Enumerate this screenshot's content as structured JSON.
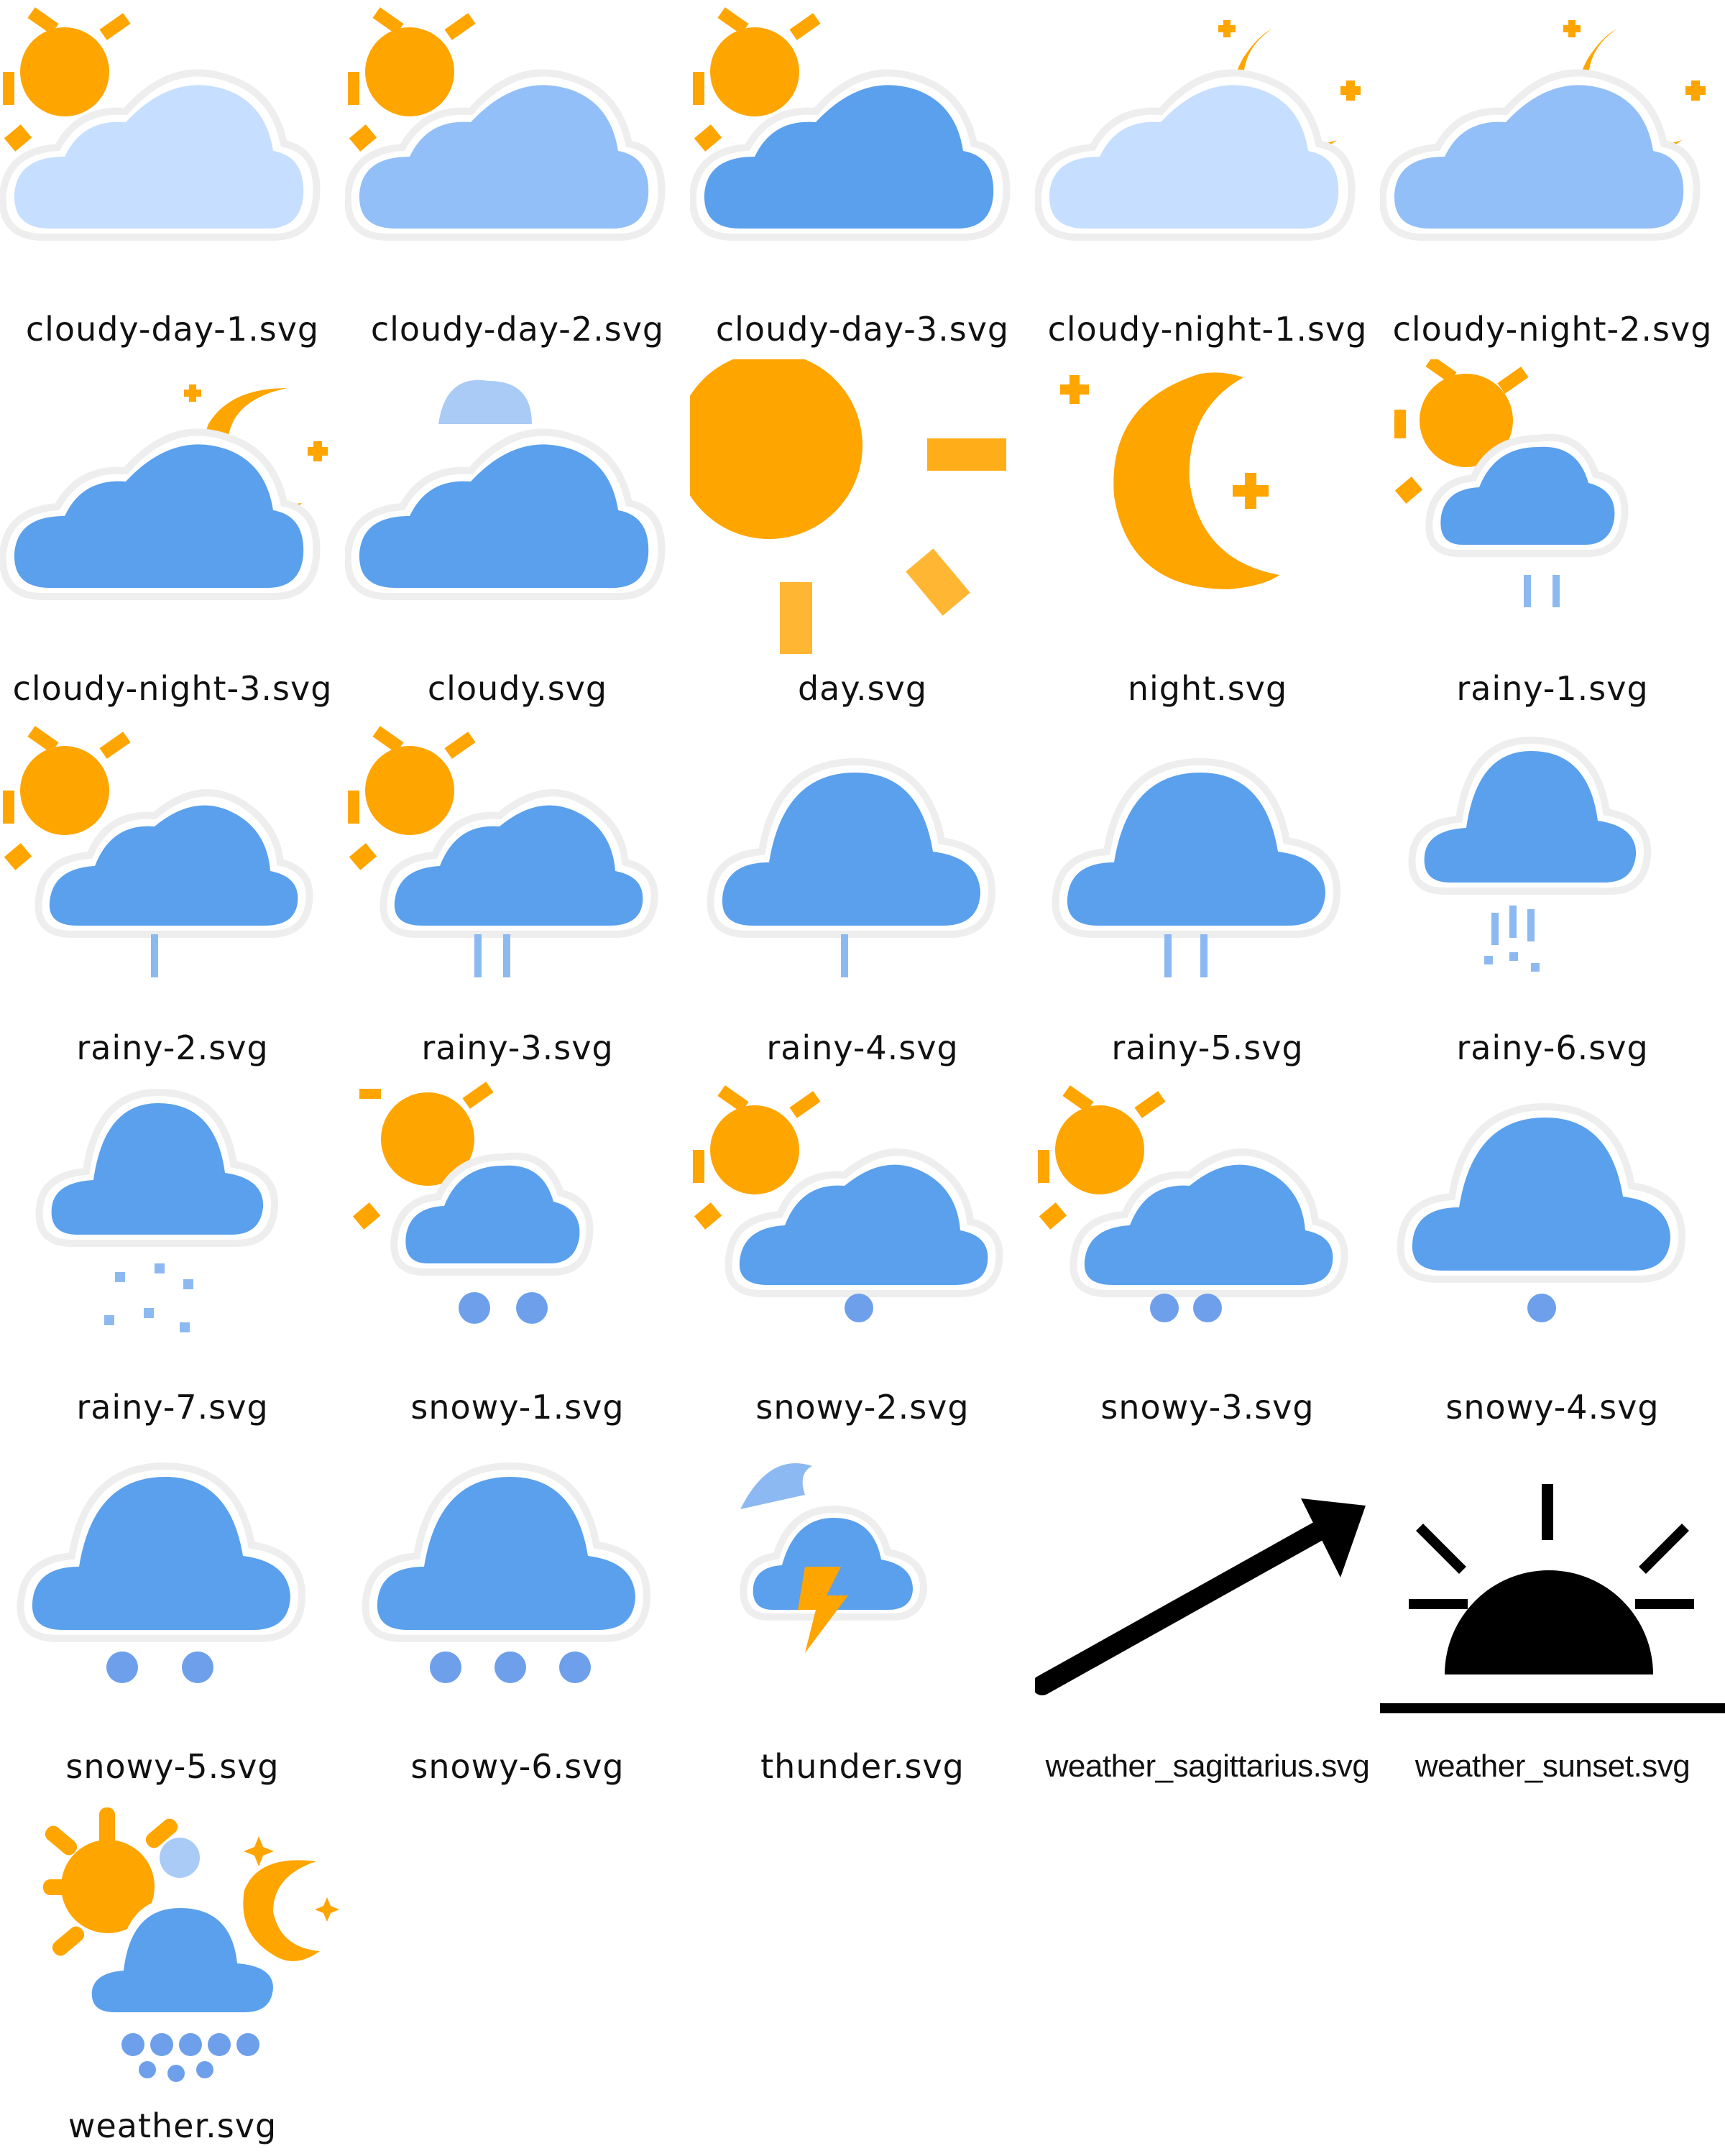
{
  "files": [
    {
      "name": "cloudy-day-1.svg",
      "icon": "cloudy-day-1-icon"
    },
    {
      "name": "cloudy-day-2.svg",
      "icon": "cloudy-day-2-icon"
    },
    {
      "name": "cloudy-day-3.svg",
      "icon": "cloudy-day-3-icon"
    },
    {
      "name": "cloudy-night-1.svg",
      "icon": "cloudy-night-1-icon"
    },
    {
      "name": "cloudy-night-2.svg",
      "icon": "cloudy-night-2-icon"
    },
    {
      "name": "cloudy-night-3.svg",
      "icon": "cloudy-night-3-icon"
    },
    {
      "name": "cloudy.svg",
      "icon": "cloudy-icon"
    },
    {
      "name": "day.svg",
      "icon": "sun-icon"
    },
    {
      "name": "night.svg",
      "icon": "moon-icon"
    },
    {
      "name": "rainy-1.svg",
      "icon": "rainy-1-icon"
    },
    {
      "name": "rainy-2.svg",
      "icon": "rainy-2-icon"
    },
    {
      "name": "rainy-3.svg",
      "icon": "rainy-3-icon"
    },
    {
      "name": "rainy-4.svg",
      "icon": "rainy-4-icon"
    },
    {
      "name": "rainy-5.svg",
      "icon": "rainy-5-icon"
    },
    {
      "name": "rainy-6.svg",
      "icon": "rainy-6-icon"
    },
    {
      "name": "rainy-7.svg",
      "icon": "rainy-7-icon"
    },
    {
      "name": "snowy-1.svg",
      "icon": "snowy-1-icon"
    },
    {
      "name": "snowy-2.svg",
      "icon": "snowy-2-icon"
    },
    {
      "name": "snowy-3.svg",
      "icon": "snowy-3-icon"
    },
    {
      "name": "snowy-4.svg",
      "icon": "snowy-4-icon"
    },
    {
      "name": "snowy-5.svg",
      "icon": "snowy-5-icon"
    },
    {
      "name": "snowy-6.svg",
      "icon": "snowy-6-icon"
    },
    {
      "name": "thunder.svg",
      "icon": "thunder-icon"
    },
    {
      "name": "weather_sagittarius.svg",
      "icon": "arrow-icon"
    },
    {
      "name": "weather_sunset.svg",
      "icon": "sunset-icon"
    },
    {
      "name": "weather.svg",
      "icon": "weather-icon"
    }
  ],
  "colors": {
    "sun": "#FFA500",
    "cloud_light": "#C6DEFF",
    "cloud_mid": "#92BFF7",
    "cloud_dark": "#5AA0EC",
    "drop": "#8DB9F2",
    "snow": "#6E9FEA",
    "black": "#000000"
  }
}
